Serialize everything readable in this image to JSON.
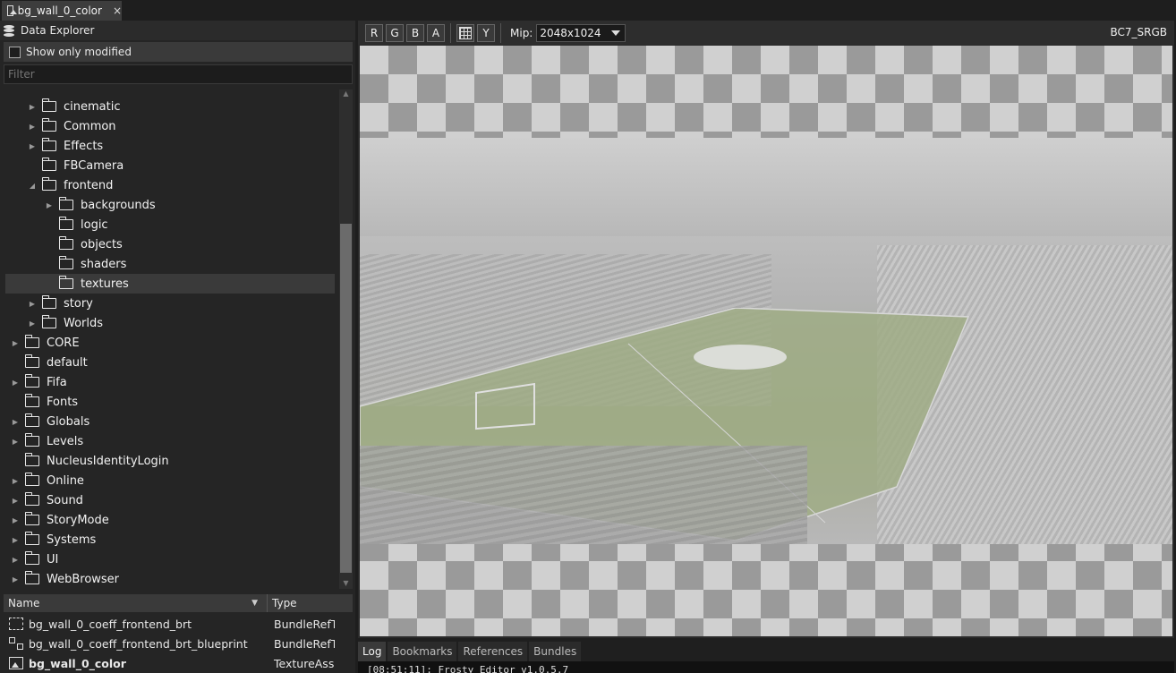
{
  "document_tab": {
    "title": "bg_wall_0_color",
    "close": "×"
  },
  "explorer": {
    "title": "Data Explorer",
    "show_only_modified": "Show only modified",
    "filter_placeholder": "Filter",
    "tree": [
      {
        "label": "cinematic",
        "level": 2,
        "expandable": true
      },
      {
        "label": "Common",
        "level": 2,
        "expandable": true
      },
      {
        "label": "Effects",
        "level": 2,
        "expandable": true
      },
      {
        "label": "FBCamera",
        "level": 2,
        "expandable": false
      },
      {
        "label": "frontend",
        "level": 2,
        "expandable": true,
        "expanded": true
      },
      {
        "label": "backgrounds",
        "level": 3,
        "expandable": true
      },
      {
        "label": "logic",
        "level": 3,
        "expandable": false
      },
      {
        "label": "objects",
        "level": 3,
        "expandable": false
      },
      {
        "label": "shaders",
        "level": 3,
        "expandable": false
      },
      {
        "label": "textures",
        "level": 3,
        "expandable": false,
        "selected": true
      },
      {
        "label": "story",
        "level": 2,
        "expandable": true
      },
      {
        "label": "Worlds",
        "level": 2,
        "expandable": true
      },
      {
        "label": "CORE",
        "level": 1,
        "expandable": true
      },
      {
        "label": "default",
        "level": 1,
        "expandable": false
      },
      {
        "label": "Fifa",
        "level": 1,
        "expandable": true
      },
      {
        "label": "Fonts",
        "level": 1,
        "expandable": false
      },
      {
        "label": "Globals",
        "level": 1,
        "expandable": true
      },
      {
        "label": "Levels",
        "level": 1,
        "expandable": true
      },
      {
        "label": "NucleusIdentityLogin",
        "level": 1,
        "expandable": false
      },
      {
        "label": "Online",
        "level": 1,
        "expandable": true
      },
      {
        "label": "Sound",
        "level": 1,
        "expandable": true
      },
      {
        "label": "StoryMode",
        "level": 1,
        "expandable": true
      },
      {
        "label": "Systems",
        "level": 1,
        "expandable": true
      },
      {
        "label": "UI",
        "level": 1,
        "expandable": true
      },
      {
        "label": "WebBrowser",
        "level": 1,
        "expandable": true
      }
    ]
  },
  "asset_list": {
    "columns": {
      "name": "Name",
      "type": "Type"
    },
    "rows": [
      {
        "name": "bg_wall_0_coeff_frontend_brt",
        "type": "BundleRefT",
        "icon": "bundle-icon"
      },
      {
        "name": "bg_wall_0_coeff_frontend_brt_blueprint",
        "type": "BundleRefT",
        "icon": "blueprint-icon"
      },
      {
        "name": "bg_wall_0_color",
        "type": "TextureAss",
        "icon": "texture-icon",
        "bold": true
      }
    ]
  },
  "viewer": {
    "channels": [
      "R",
      "G",
      "B",
      "A"
    ],
    "y_button": "Y",
    "mip_label": "Mip:",
    "mip_value": "2048x1024",
    "format": "BC7_SRGB"
  },
  "bottom_tabs": [
    "Log",
    "Bookmarks",
    "References",
    "Bundles"
  ],
  "log": {
    "line": "[08:51:11]: Frosty Editor v1.0.5.7"
  }
}
